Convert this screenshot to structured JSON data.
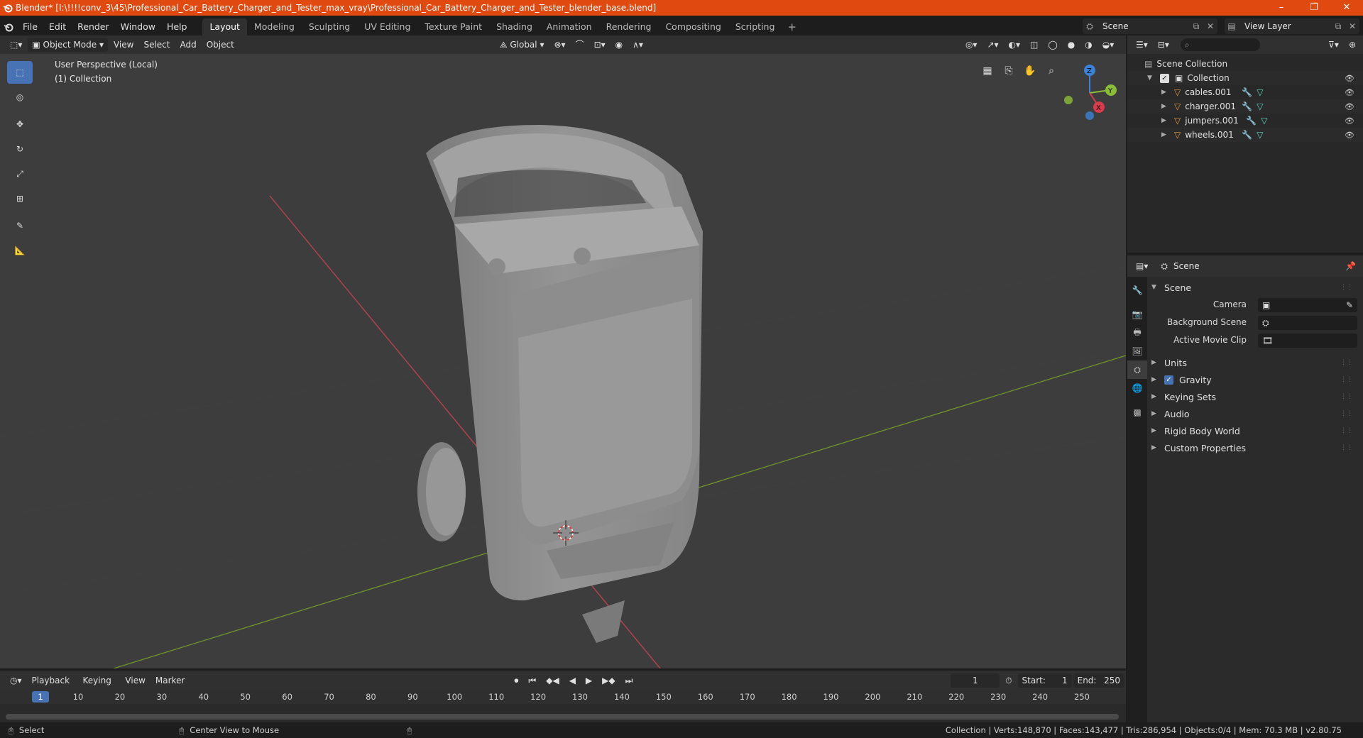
{
  "titlebar": {
    "title": "Blender* [I:\\!!!!conv_3\\45\\Professional_Car_Battery_Charger_and_Tester_max_vray\\Professional_Car_Battery_Charger_and_Tester_blender_base.blend]",
    "minimize": "–",
    "maximize": "❐",
    "close": "✕"
  },
  "menubar": {
    "items": [
      "File",
      "Edit",
      "Render",
      "Window",
      "Help"
    ],
    "workspaces": [
      "Layout",
      "Modeling",
      "Sculpting",
      "UV Editing",
      "Texture Paint",
      "Shading",
      "Animation",
      "Rendering",
      "Compositing",
      "Scripting"
    ],
    "active_workspace": "Layout",
    "add_workspace": "+",
    "scene": "Scene",
    "view_layer": "View Layer"
  },
  "viewport_header": {
    "mode": "Object Mode",
    "menus": [
      "View",
      "Select",
      "Add",
      "Object"
    ],
    "transform_orientation": "Global"
  },
  "viewport": {
    "perspective_label": "User Perspective (Local)",
    "collection_label": "(1) Collection",
    "gizmo_axes": [
      "Z",
      "Y",
      "X"
    ]
  },
  "outliner": {
    "root": "Scene Collection",
    "collection": "Collection",
    "objects": [
      "cables.001",
      "charger.001",
      "jumpers.001",
      "wheels.001"
    ]
  },
  "properties": {
    "header_title": "Scene",
    "panel_title": "Scene",
    "fields": [
      {
        "label": "Camera"
      },
      {
        "label": "Background Scene"
      },
      {
        "label": "Active Movie Clip"
      }
    ],
    "subpanels": [
      "Units",
      "Gravity",
      "Keying Sets",
      "Audio",
      "Rigid Body World",
      "Custom Properties"
    ],
    "gravity_checked": true
  },
  "timeline": {
    "menus": [
      "Playback",
      "Keying",
      "View",
      "Marker"
    ],
    "current_frame": "1",
    "start_label": "Start:",
    "start": "1",
    "end_label": "End:",
    "end": "250",
    "ruler": [
      "1",
      "10",
      "20",
      "30",
      "40",
      "50",
      "60",
      "70",
      "80",
      "90",
      "100",
      "110",
      "120",
      "130",
      "140",
      "150",
      "160",
      "170",
      "180",
      "190",
      "200",
      "210",
      "220",
      "230",
      "240",
      "250"
    ]
  },
  "statusbar": {
    "left_action": "Select",
    "middle_action": "Center View to Mouse",
    "stats": "Collection | Verts:148,870 | Faces:143,477 | Tris:286,954 | Objects:0/4 | Mem: 70.3 MB | v2.80.75"
  },
  "colors": {
    "titlebar": "#e0490f",
    "accent": "#4772b3",
    "x_axis": "#d93a4c",
    "y_axis": "#8bbd38",
    "z_axis": "#3b82d6"
  }
}
